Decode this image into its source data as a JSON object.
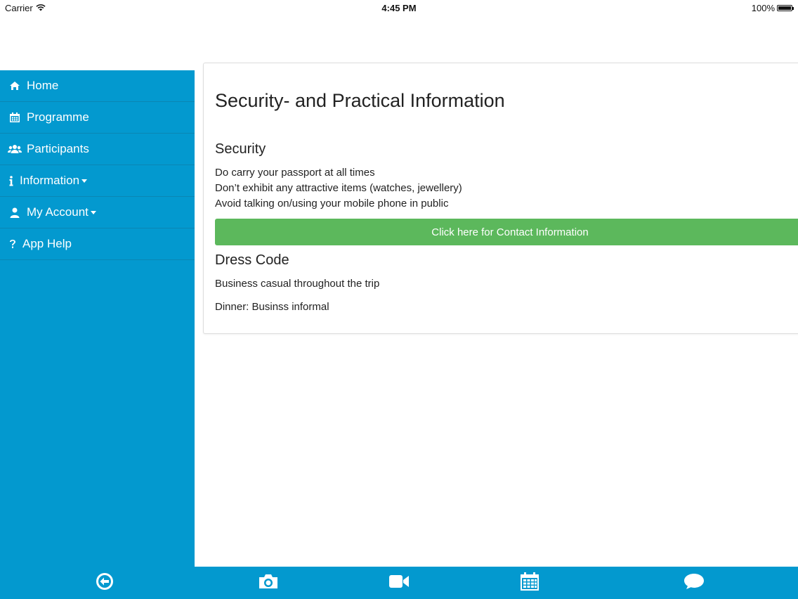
{
  "status_bar": {
    "carrier": "Carrier",
    "time": "4:45 PM",
    "battery": "100%",
    "battery_level": 1.0
  },
  "sidebar": {
    "items": [
      {
        "label": "Home",
        "icon": "home-icon",
        "has_dropdown": false
      },
      {
        "label": "Programme",
        "icon": "calendar-icon",
        "has_dropdown": false
      },
      {
        "label": "Participants",
        "icon": "users-icon",
        "has_dropdown": false
      },
      {
        "label": "Information",
        "icon": "info-icon",
        "has_dropdown": true
      },
      {
        "label": "My Account",
        "icon": "user-icon",
        "has_dropdown": true
      },
      {
        "label": "App Help",
        "icon": "question-icon",
        "has_dropdown": false
      }
    ]
  },
  "main": {
    "title": "Security- and Practical Information",
    "security": {
      "heading": "Security",
      "lines": [
        "Do carry your passport at all times",
        "Don’t exhibit any attractive items (watches, jewellery)",
        "Avoid talking on/using your mobile phone in public"
      ]
    },
    "contact_button": "Click here for Contact Information",
    "dress_code": {
      "heading": "Dress Code",
      "lines": [
        "Business casual throughout the trip",
        "Dinner: Businss informal"
      ]
    }
  },
  "tabbar": {
    "items": [
      {
        "icon": "back-circle-icon"
      },
      {
        "icon": "camera-icon"
      },
      {
        "icon": "video-camera-icon"
      },
      {
        "icon": "calendar-icon"
      },
      {
        "icon": "chat-bubble-icon"
      }
    ]
  },
  "colors": {
    "primary": "#0399cf",
    "button_green": "#5cb85c",
    "text": "#222222"
  }
}
